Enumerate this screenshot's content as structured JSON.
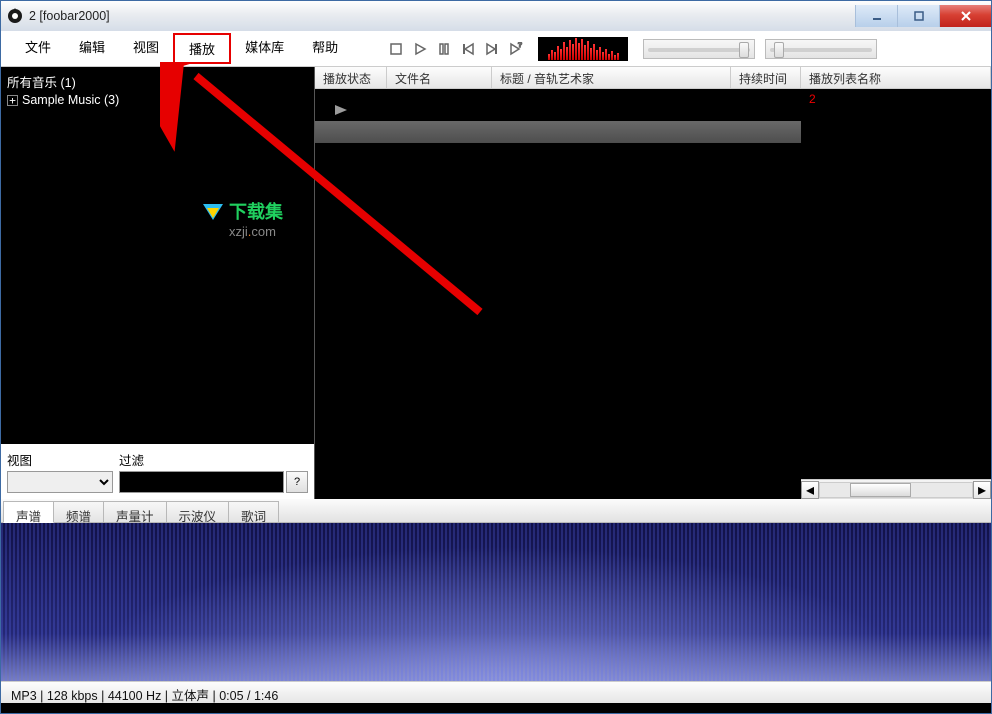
{
  "window": {
    "title": "2  [foobar2000]"
  },
  "menu": {
    "file": "文件",
    "edit": "编辑",
    "view": "视图",
    "play": "播放",
    "library": "媒体库",
    "help": "帮助"
  },
  "sliders": {
    "seek_pos": 0.95,
    "volume_pos": 0.08
  },
  "tree": {
    "root": "所有音乐 (1)",
    "child": "Sample Music (3)"
  },
  "filters": {
    "view_label": "视图",
    "filter_label": "过滤",
    "qmark": "?"
  },
  "columns": {
    "status": "播放状态",
    "filename": "文件名",
    "title_artist": "标题 / 音轨艺术家",
    "duration": "持续时间",
    "playlist_name": "播放列表名称"
  },
  "playlist_right": {
    "item": "2"
  },
  "tabs": {
    "spectrogram": "声谱",
    "spectrum": "频谱",
    "vumeter": "声量计",
    "oscilloscope": "示波仪",
    "lyrics": "歌词"
  },
  "watermark": {
    "line1": "下载集",
    "line2": "xzji.com"
  },
  "status_bar": "MP3 | 128 kbps | 44100 Hz | 立体声 | 0:05 / 1:46"
}
